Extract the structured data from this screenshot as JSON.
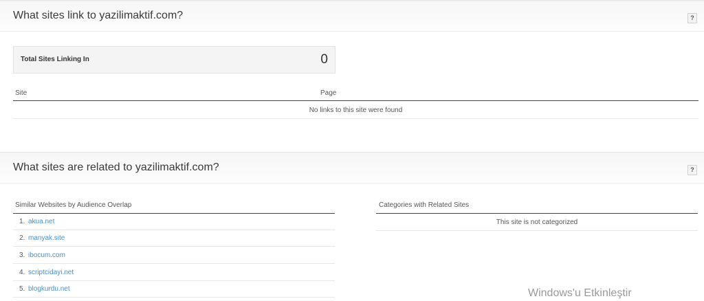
{
  "links_section": {
    "title": "What sites link to yazilimaktif.com?",
    "help": "?",
    "total_label": "Total Sites Linking In",
    "total_value": "0",
    "columns": {
      "site": "Site",
      "page": "Page"
    },
    "empty_message": "No links to this site were found"
  },
  "related_section": {
    "title": "What sites are related to yazilimaktif.com?",
    "help": "?",
    "similar_heading": "Similar Websites by Audience Overlap",
    "similar_sites": [
      {
        "num": "1.",
        "name": "akua.net"
      },
      {
        "num": "2.",
        "name": "manyak.site"
      },
      {
        "num": "3.",
        "name": "ibocum.com"
      },
      {
        "num": "4.",
        "name": "scriptcidayi.net"
      },
      {
        "num": "5.",
        "name": "blogkurdu.net"
      }
    ],
    "categories_heading": "Categories with Related Sites",
    "categories_message": "This site is not categorized"
  },
  "watermark": "Windows'u Etkinleştir",
  "colors": {
    "link": "#4a90c8",
    "rule": "#444444",
    "header_bg": "#f6f6f6"
  }
}
